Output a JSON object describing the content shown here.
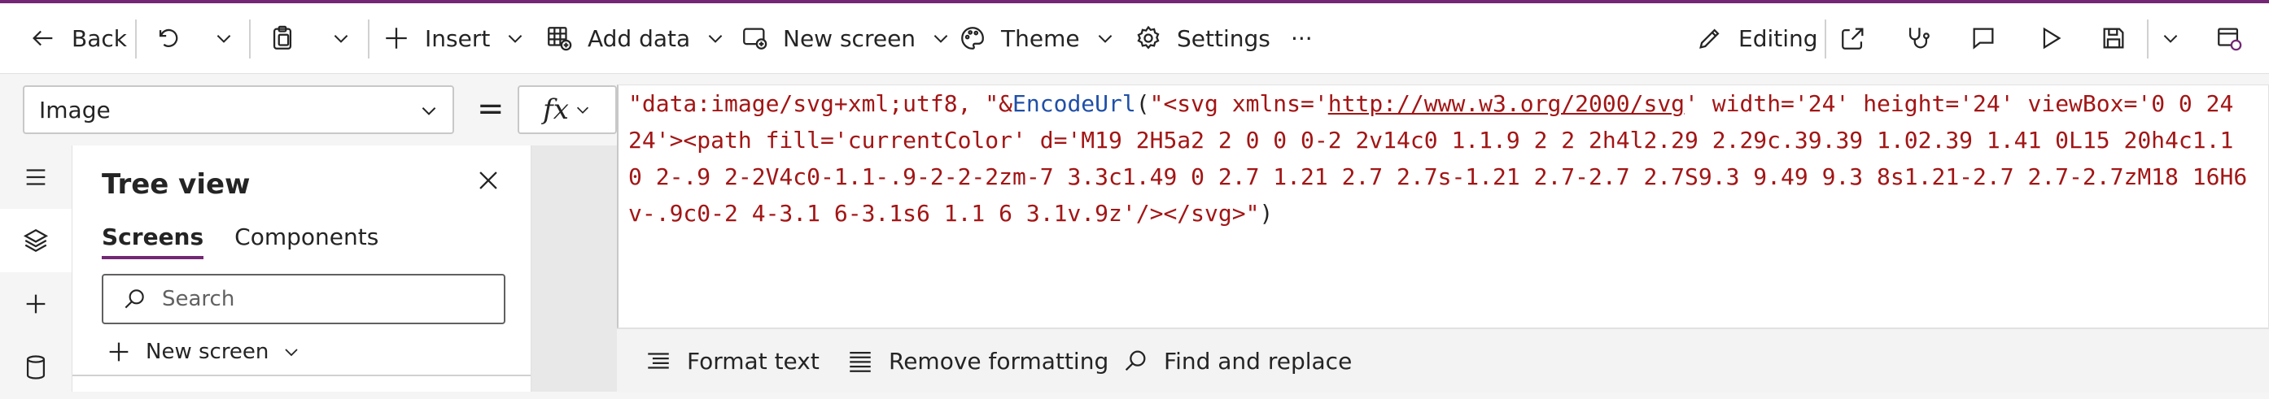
{
  "command_bar": {
    "back": "Back",
    "insert": "Insert",
    "add_data": "Add data",
    "new_screen": "New screen",
    "theme": "Theme",
    "settings": "Settings",
    "more": "···",
    "editing": "Editing"
  },
  "formula_bar": {
    "property": "Image",
    "equals": "=",
    "fx": "fx",
    "formula_prefix": "\"data:image/svg+xml;utf8, \"&",
    "formula_function": "EncodeUrl",
    "formula_open": "(",
    "formula_string_start": "\"<svg xmlns='",
    "formula_url": "http://www.w3.org/2000/svg",
    "formula_string_rest": "' width='24' height='24' viewBox='0 0 24 24'><path fill='currentColor' d='M19 2H5a2 2 0 0 0-2 2v14c0 1.1.9 2 2 2h4l2.29 2.29c.39.39 1.02.39 1.41 0L15 20h4c1.1 0 2-.9 2-2V4c0-1.1-.9-2-2-2zm-7 3.3c1.49 0 2.7 1.21 2.7 2.7s-1.21 2.7-2.7 2.7S9.3 9.49 9.3 8s1.21-2.7 2.7-2.7zM18 16H6v-.9c0-2 4-3.1 6-3.1s6 1.1 6 3.1v.9z'/></svg>\"",
    "formula_close": ")",
    "format_text": "Format text",
    "remove_formatting": "Remove formatting",
    "find_replace": "Find and replace"
  },
  "tree_view": {
    "title": "Tree view",
    "tabs": [
      "Screens",
      "Components"
    ],
    "search_placeholder": "Search",
    "new_screen": "New screen"
  },
  "colors": {
    "accent": "#742774",
    "formula_string": "#a31515",
    "formula_function": "#1f4fa8"
  }
}
